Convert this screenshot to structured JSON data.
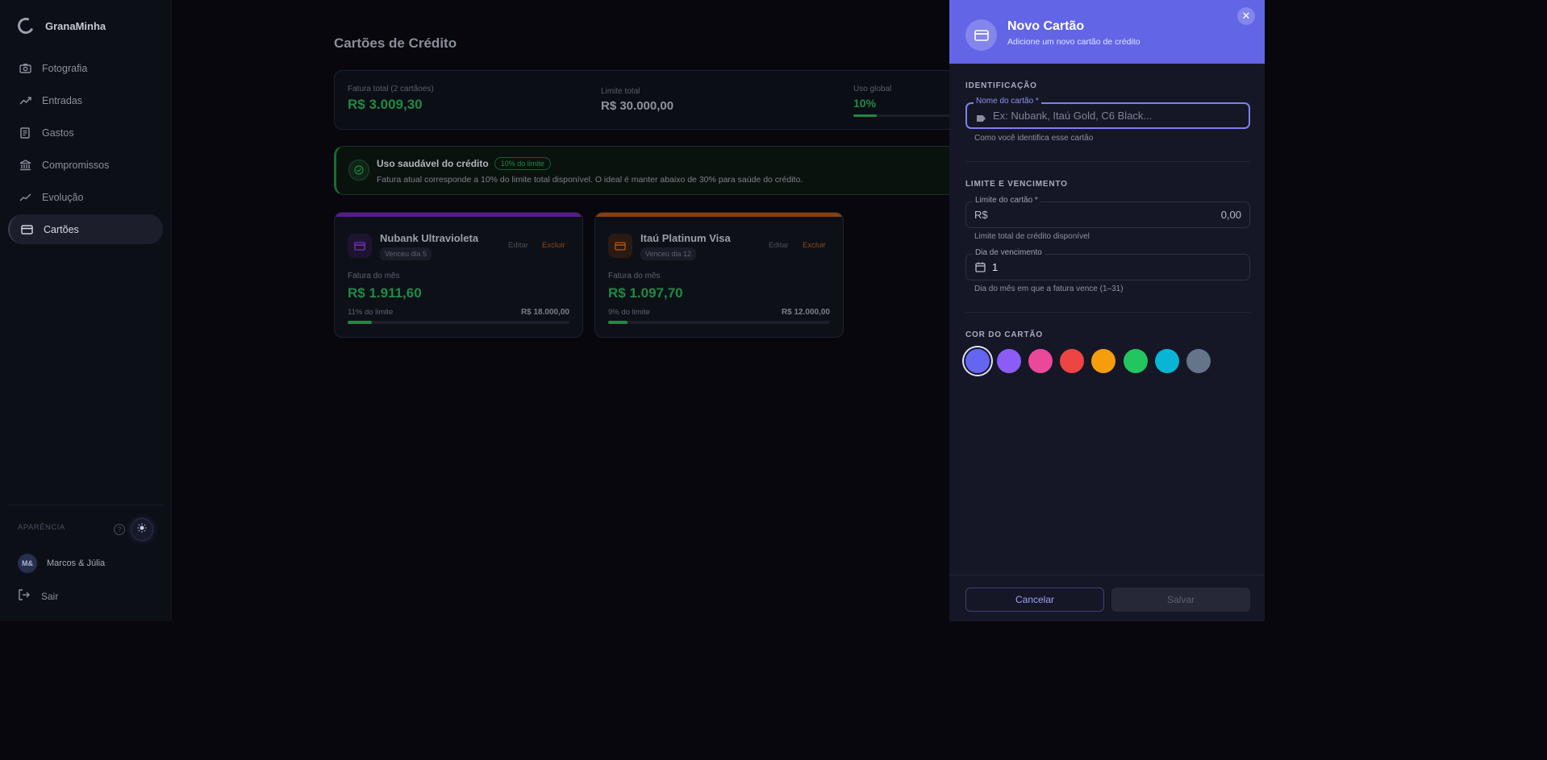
{
  "app": {
    "name": "GranaMinha"
  },
  "nav": [
    {
      "label": "Fotografia",
      "icon": "camera-icon"
    },
    {
      "label": "Entradas",
      "icon": "trending-up-icon"
    },
    {
      "label": "Gastos",
      "icon": "receipt-icon"
    },
    {
      "label": "Compromissos",
      "icon": "bank-icon"
    },
    {
      "label": "Evolução",
      "icon": "chart-line-icon"
    },
    {
      "label": "Cartões",
      "icon": "credit-card-icon",
      "active": true
    }
  ],
  "sidebar_footer": {
    "appearance_label": "APARÊNCIA",
    "help_glyph": "?",
    "user_initials": "M&",
    "user_name": "Marcos & Júlia",
    "logout_label": "Sair"
  },
  "page": {
    "title": "Cartões de Crédito",
    "summary": {
      "total_label": "Fatura total (2 cartãoes)",
      "total_value": "R$ 3.009,30",
      "limit_label": "Limite total",
      "limit_value": "R$ 30.000,00",
      "usage_label": "Uso global",
      "usage_value": "10%",
      "usage_fraction": 0.1
    },
    "alert": {
      "title": "Uso saudável do crédito",
      "badge": "10% do limite",
      "text": "Fatura atual corresponde a 10% do limite total disponível. O ideal é manter abaixo de 30% para saúde do crédito."
    },
    "cards": [
      {
        "name": "Nubank Ultravioleta",
        "due": "Venceu dia 5",
        "edit": "Editar",
        "delete": "Excluir",
        "bill_label": "Fatura do mês",
        "amount": "R$ 1.911,60",
        "pct_label": "11% do limite",
        "limit": "R$ 18.000,00",
        "usage_fraction": 0.11,
        "color": "#6b21a8"
      },
      {
        "name": "Itaú Platinum Visa",
        "due": "Venceu dia 12",
        "edit": "Editar",
        "delete": "Excluir",
        "bill_label": "Fatura do mês",
        "amount": "R$ 1.097,70",
        "pct_label": "9% do limite",
        "limit": "R$ 12.000,00",
        "usage_fraction": 0.09,
        "color": "#9a4a0f"
      }
    ]
  },
  "drawer": {
    "title": "Novo Cartão",
    "subtitle": "Adicione um novo cartão de crédito",
    "close_glyph": "✕",
    "section_id": "IDENTIFICAÇÃO",
    "name_label": "Nome do cartão *",
    "name_placeholder": "Ex: Nubank, Itaú Gold, C6 Black...",
    "name_help": "Como você identifica esse cartão",
    "section_limit": "LIMITE E VENCIMENTO",
    "limit_label": "Limite do cartão *",
    "limit_prefix": "R$",
    "limit_value": "0,00",
    "limit_help": "Limite total de crédito disponível",
    "due_label": "Dia de vencimento",
    "due_value": "1",
    "due_help": "Dia do mês em que a fatura vence (1–31)",
    "section_color": "COR DO CARTÃO",
    "colors": [
      "#6366f1",
      "#8b5cf6",
      "#ec4899",
      "#ef4444",
      "#f59e0b",
      "#22c55e",
      "#06b6d4",
      "#64748b"
    ],
    "selected_color": "#6366f1",
    "cancel_label": "Cancelar",
    "save_label": "Salvar"
  }
}
